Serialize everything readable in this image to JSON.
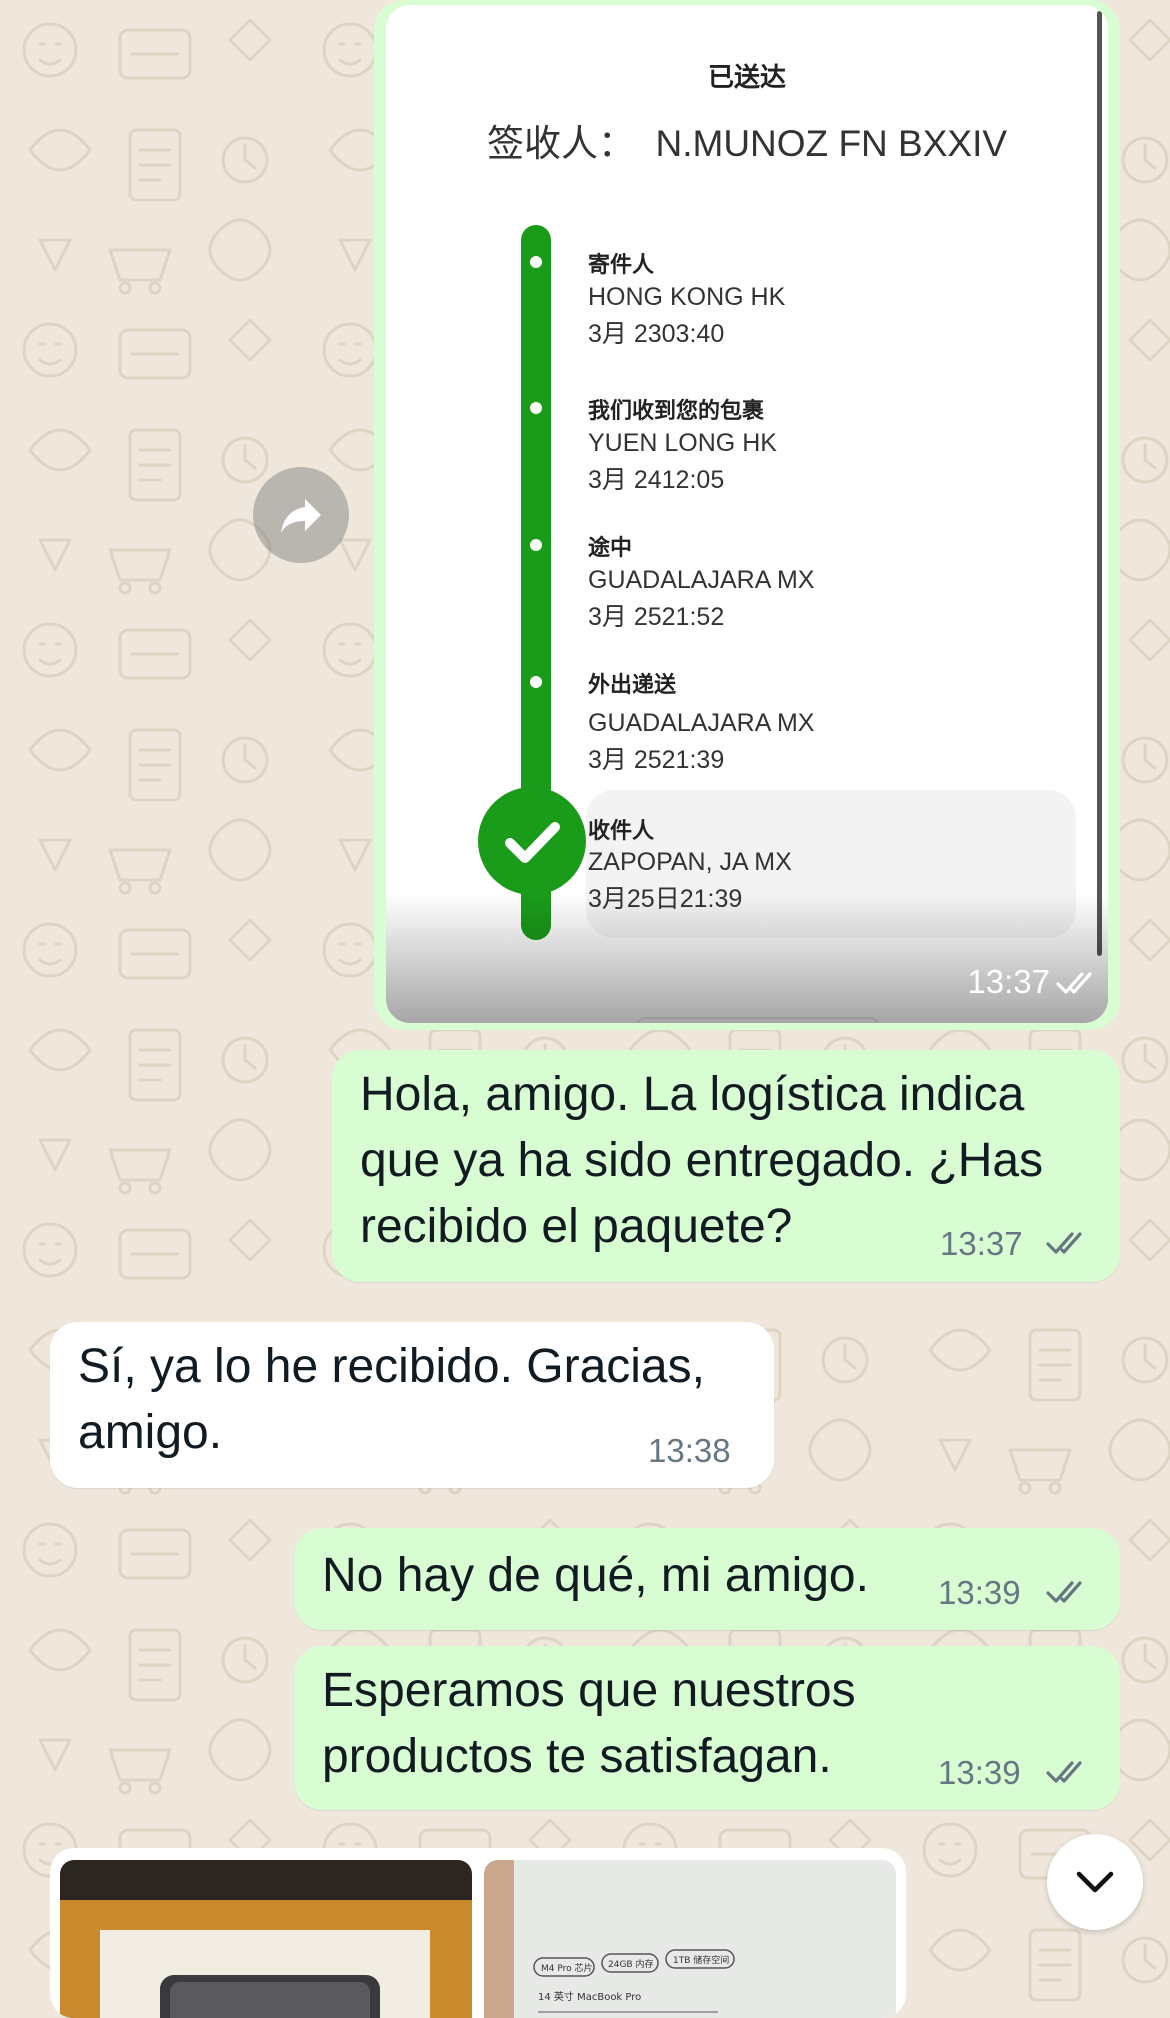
{
  "tracking_card": {
    "status_title": "已送达",
    "signer_label": "签收人：",
    "signer_name": "N.MUNOZ FN BXXIV",
    "events": [
      {
        "status": "寄件人",
        "location": "HONG KONG HK",
        "datetime": "3月 2303:40"
      },
      {
        "status": "我们收到您的包裹",
        "location": "YUEN LONG HK",
        "datetime": "3月 2412:05"
      },
      {
        "status": "途中",
        "location": "GUADALAJARA MX",
        "datetime": "3月 2521:52"
      },
      {
        "status": "外出递送",
        "location": "GUADALAJARA MX",
        "datetime": "3月 2521:39"
      },
      {
        "status": "收件人",
        "location": "ZAPOPAN, JA MX",
        "datetime": "3月25日21:39"
      }
    ],
    "time": "13:37"
  },
  "messages": [
    {
      "direction": "out",
      "lines": [
        "Hola, amigo. La logística indica",
        "que ya ha sido entregado. ¿Has",
        "recibido el paquete?"
      ],
      "time": "13:37"
    },
    {
      "direction": "in",
      "lines": [
        "Sí, ya lo he recibido. Gracias,",
        "amigo."
      ],
      "time": "13:38"
    },
    {
      "direction": "out",
      "lines": [
        "No hay de qué, mi amigo."
      ],
      "time": "13:39"
    },
    {
      "direction": "out",
      "lines": [
        "Esperamos que nuestros",
        "productos te satisfagan."
      ],
      "time": "13:39"
    }
  ],
  "media": {
    "thumb2_tags": [
      "M4 Pro 芯片",
      "24GB 内存",
      "1TB 储存空间"
    ],
    "thumb2_caption": "14 英寸 MacBook Pro"
  },
  "icons": {
    "forward": "forward-icon",
    "scroll_down": "chevron-down-icon",
    "read_receipt": "double-check-icon",
    "delivered": "check-icon"
  },
  "colors": {
    "outgoing_bubble": "#d9fdd3",
    "incoming_bubble": "#ffffff",
    "chat_background": "#efe7dc",
    "read_ticks": "#667781",
    "tracking_green": "#1a9b1a"
  }
}
